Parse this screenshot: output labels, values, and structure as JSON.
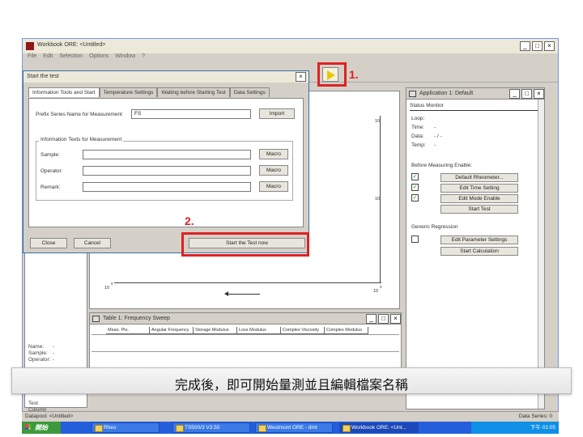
{
  "window": {
    "title": "Workbook ORE: <Untitled>",
    "menu": [
      "File",
      "Edit",
      "Selection",
      "Options",
      "Window",
      "?"
    ]
  },
  "annotations": {
    "step1": "1.",
    "step2": "2."
  },
  "dialog": {
    "title": "Start the test",
    "tabs": [
      "Information Tools and Start",
      "Temperature Settings",
      "Waiting before Starting Test",
      "Data Settings"
    ],
    "prefix_label": "Prefix Series Name for Measurement",
    "prefix_value": "FS",
    "import_label": "Import",
    "group_label": "Information Texts for Measurement",
    "fields": [
      {
        "label": "Sample:",
        "value": "",
        "macro": "Macro"
      },
      {
        "label": "Operator:",
        "value": "",
        "macro": "Macro"
      },
      {
        "label": "Remark:",
        "value": "",
        "macro": "Macro"
      }
    ],
    "close_label": "Close",
    "cancel_label": "Cancel",
    "start_label": "Start the Test now"
  },
  "graph": {
    "tick_x_left": "10",
    "tick_x_left_exp": "0",
    "tick_x_right": "10",
    "tick_x_right_exp": "0",
    "tick_y_top": "10",
    "tick_y_mid": "10"
  },
  "app_panel": {
    "title": "Application 1: Default",
    "status_monitor": "Status Monitor",
    "status_rows": [
      {
        "k": "Loop:",
        "v": ""
      },
      {
        "k": "Time:",
        "v": "-"
      },
      {
        "k": "Data:",
        "v": "- / -"
      },
      {
        "k": "Temp:",
        "v": "-"
      }
    ],
    "measuring_label": "Before Measuring Enable:",
    "buttons": [
      "Default Rheometer...",
      "Edit Time Setting",
      "Edit Mode Enable",
      "Start Test"
    ],
    "regression_label": "Generic Regression",
    "buttons2": [
      "Edit Parameter Settings",
      "Start Calculation"
    ]
  },
  "table_panel": {
    "title": "Table 1: Frequency Sweep",
    "headers": [
      "Meas. Pts.",
      "Angular Frequency",
      "Storage Modulus",
      "Loss Modulus",
      "Complex Viscosity",
      "Complex Modulus"
    ]
  },
  "left_panel": {
    "info_rows": [
      {
        "k": "Name:",
        "v": "-"
      },
      {
        "k": "Sample:",
        "v": "-"
      },
      {
        "k": "Operator:",
        "v": "-"
      }
    ],
    "lower_rows": [
      "Test",
      "Column"
    ]
  },
  "caption": "完成後，即可開始量測並且編輯檔案名稱",
  "statusbar": {
    "left": "Datapool: <Untitled>",
    "right": "Data Series: 0"
  },
  "taskbar": {
    "start": "開始",
    "tasks": [
      "Rheo",
      "TS500/3 V3.50",
      "Westmont ORE - dmt",
      "Workbook ORE: <Unt..."
    ],
    "clock": "下午 01:05"
  },
  "colors": {
    "highlight": "#dd2222",
    "taskbar": "#245edb"
  }
}
